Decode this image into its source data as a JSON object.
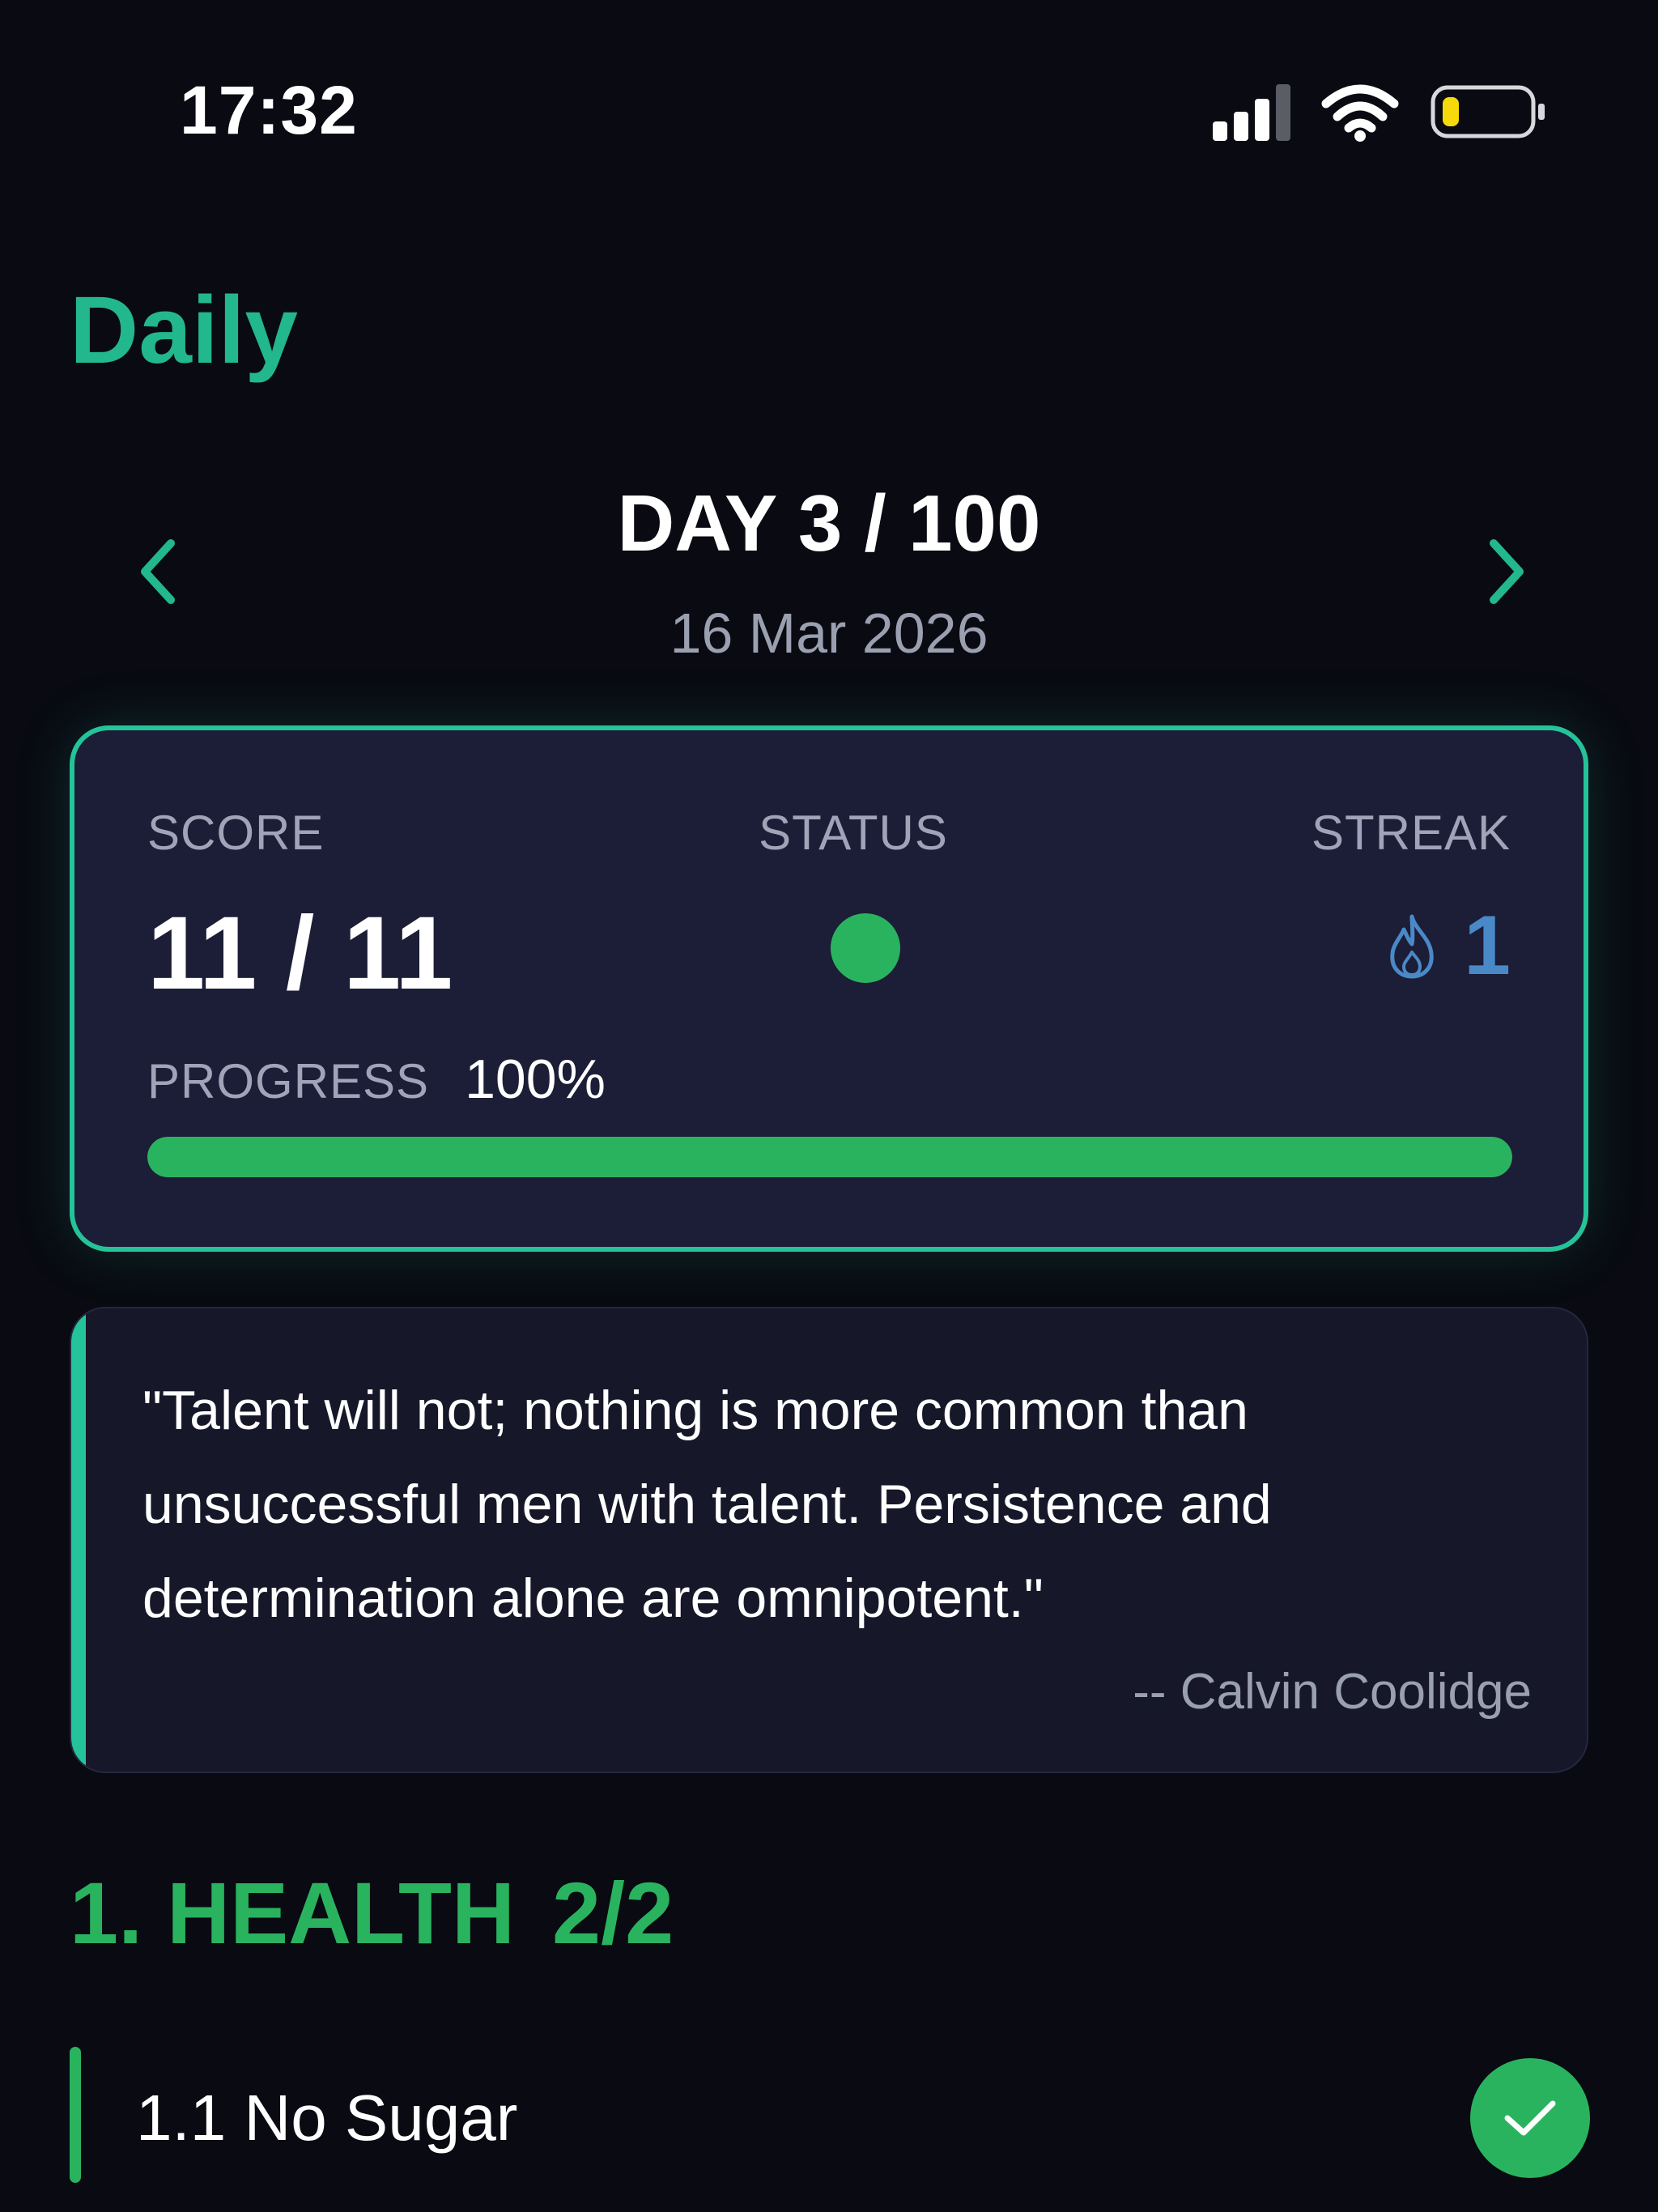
{
  "status_bar": {
    "time": "17:32",
    "icons": [
      "signal-icon",
      "wifi-icon",
      "battery-icon"
    ],
    "battery_color": "#f5d90a"
  },
  "header": {
    "title": "Daily"
  },
  "day_nav": {
    "prev_icon": "chevron-left-icon",
    "next_icon": "chevron-right-icon",
    "day_label": "DAY 3 / 100",
    "date": "16 Mar 2026"
  },
  "score_card": {
    "score_label": "SCORE",
    "score_value": "11 / 11",
    "status_label": "STATUS",
    "status_color": "#2ab35f",
    "streak_label": "STREAK",
    "streak_icon": "flame-icon",
    "streak_value": "1",
    "progress_label": "PROGRESS",
    "progress_value": "100%",
    "progress_fraction": 1.0
  },
  "quote": {
    "text": "\"Talent will not; nothing is more common than unsuccessful men with talent. Persistence and determination alone are omnipotent.\"",
    "author": "-- Calvin Coolidge"
  },
  "section": {
    "title": "1. HEALTH",
    "count": "2/2"
  },
  "tasks": [
    {
      "label": "1.1 No Sugar",
      "done_icon": "check-icon"
    }
  ],
  "colors": {
    "accent": "#22b78c",
    "success": "#2ab35f",
    "streak": "#4a89c8",
    "background": "#090a12",
    "card": "#1c1d36"
  }
}
